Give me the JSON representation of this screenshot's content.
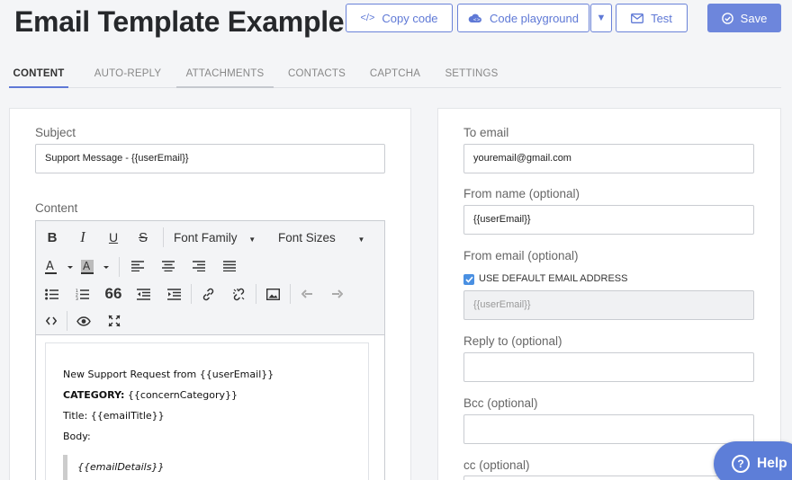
{
  "page": {
    "title": "Email Template Example"
  },
  "toolbar": {
    "copy_code": "Copy code",
    "code_playground": "Code playground",
    "test": "Test",
    "save": "Save"
  },
  "tabs": [
    {
      "label": "CONTENT",
      "active": true
    },
    {
      "label": "AUTO-REPLY"
    },
    {
      "label": "ATTACHMENTS"
    },
    {
      "label": "CONTACTS"
    },
    {
      "label": "CAPTCHA"
    },
    {
      "label": "SETTINGS"
    }
  ],
  "content": {
    "subject_label": "Subject",
    "subject_value": "Support Message - {{userEmail}}",
    "content_label": "Content",
    "editor": {
      "font_family": "Font Family",
      "font_sizes": "Font Sizes",
      "quote_glyph": "66",
      "body": {
        "line1": "New Support Request from {{userEmail}}",
        "category_label": "CATEGORY:",
        "category_value": "{{concernCategory}}",
        "line3": "Title: {{emailTitle}}",
        "line4": "Body:",
        "quote": "{{emailDetails}}"
      }
    }
  },
  "settings": {
    "to_email_label": "To email",
    "to_email_value": "youremail@gmail.com",
    "from_name_label": "From name (optional)",
    "from_name_value": "{{userEmail}}",
    "from_email_label": "From email (optional)",
    "use_default_label": "USE DEFAULT EMAIL ADDRESS",
    "use_default_checked": true,
    "from_email_value": "{{userEmail}}",
    "reply_to_label": "Reply to (optional)",
    "reply_to_value": "",
    "bcc_label": "Bcc (optional)",
    "bcc_value": "",
    "cc_label": "cc (optional)"
  },
  "help": {
    "label": "Help"
  },
  "colors": {
    "accent": "#5f79d6",
    "save_bg": "#6d86dc",
    "help_bg": "#5d7ed8",
    "checkbox": "#4a90e2"
  }
}
